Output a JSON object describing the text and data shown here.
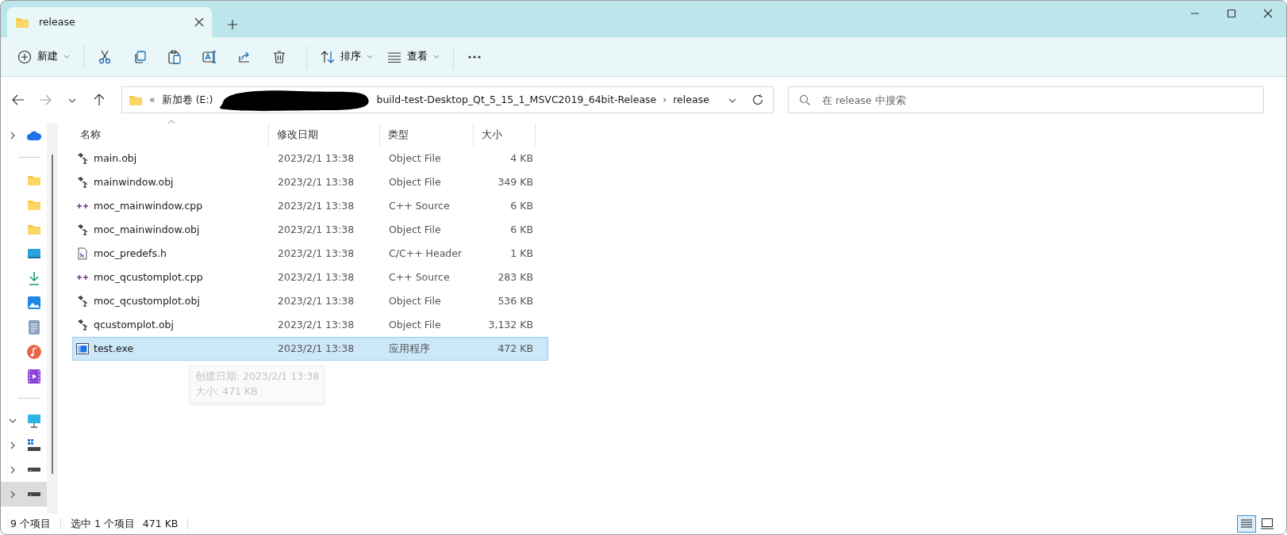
{
  "tabs": [
    {
      "label": "release",
      "selected": true
    }
  ],
  "toolbar": {
    "new_label": "新建",
    "sort_label": "排序",
    "view_label": "查看"
  },
  "navigation": {
    "forward_disabled": true
  },
  "address_bar": {
    "overflow": "«",
    "items": [
      {
        "kind": "segment",
        "label": "新加卷 (E:)"
      },
      {
        "kind": "redaction"
      },
      {
        "kind": "segment",
        "label": "build-test-Desktop_Qt_5_15_1_MSVC2019_64bit-Release"
      },
      {
        "kind": "segment",
        "label": "release"
      }
    ],
    "separator": "›"
  },
  "search": {
    "placeholder": "在 release 中搜索"
  },
  "sidebar": {
    "items": [
      {
        "kind": "cloud",
        "expanded": false
      },
      {
        "kind": "divider"
      },
      {
        "kind": "folder"
      },
      {
        "kind": "folder"
      },
      {
        "kind": "folder"
      },
      {
        "kind": "desktop"
      },
      {
        "kind": "download"
      },
      {
        "kind": "pictures"
      },
      {
        "kind": "documents"
      },
      {
        "kind": "music"
      },
      {
        "kind": "videos"
      },
      {
        "kind": "divider"
      },
      {
        "kind": "pc",
        "expanded": true
      },
      {
        "kind": "windows-drive",
        "expanded": false
      },
      {
        "kind": "drive",
        "expanded": false
      },
      {
        "kind": "drive",
        "expanded": false,
        "selected": true
      }
    ]
  },
  "table": {
    "columns": [
      "名称",
      "修改日期",
      "类型",
      "大小"
    ],
    "rows": [
      {
        "kind": "obj",
        "name": "main.obj",
        "modified": "2023/2/1 13:38",
        "type": "Object File",
        "size": "4 KB",
        "selected": false
      },
      {
        "kind": "obj",
        "name": "mainwindow.obj",
        "modified": "2023/2/1 13:38",
        "type": "Object File",
        "size": "349 KB",
        "selected": false
      },
      {
        "kind": "cpp",
        "name": "moc_mainwindow.cpp",
        "modified": "2023/2/1 13:38",
        "type": "C++ Source",
        "size": "6 KB",
        "selected": false
      },
      {
        "kind": "obj",
        "name": "moc_mainwindow.obj",
        "modified": "2023/2/1 13:38",
        "type": "Object File",
        "size": "6 KB",
        "selected": false
      },
      {
        "kind": "header",
        "name": "moc_predefs.h",
        "modified": "2023/2/1 13:38",
        "type": "C/C++ Header",
        "size": "1 KB",
        "selected": false
      },
      {
        "kind": "cpp",
        "name": "moc_qcustomplot.cpp",
        "modified": "2023/2/1 13:38",
        "type": "C++ Source",
        "size": "283 KB",
        "selected": false
      },
      {
        "kind": "obj",
        "name": "moc_qcustomplot.obj",
        "modified": "2023/2/1 13:38",
        "type": "Object File",
        "size": "536 KB",
        "selected": false
      },
      {
        "kind": "obj",
        "name": "qcustomplot.obj",
        "modified": "2023/2/1 13:38",
        "type": "Object File",
        "size": "3,132 KB",
        "selected": false
      },
      {
        "kind": "exe",
        "name": "test.exe",
        "modified": "2023/2/1 13:38",
        "type": "应用程序",
        "size": "472 KB",
        "selected": true
      }
    ]
  },
  "tooltip": {
    "lines": [
      "创建日期: 2023/2/1 13:38",
      "大小: 471 KB"
    ]
  },
  "status_bar": {
    "count": "9 个项目",
    "selection": "选中 1 个项目",
    "selection_size": "471 KB",
    "views": [
      {
        "kind": "details",
        "selected": true
      },
      {
        "kind": "tiles",
        "selected": false
      }
    ]
  }
}
